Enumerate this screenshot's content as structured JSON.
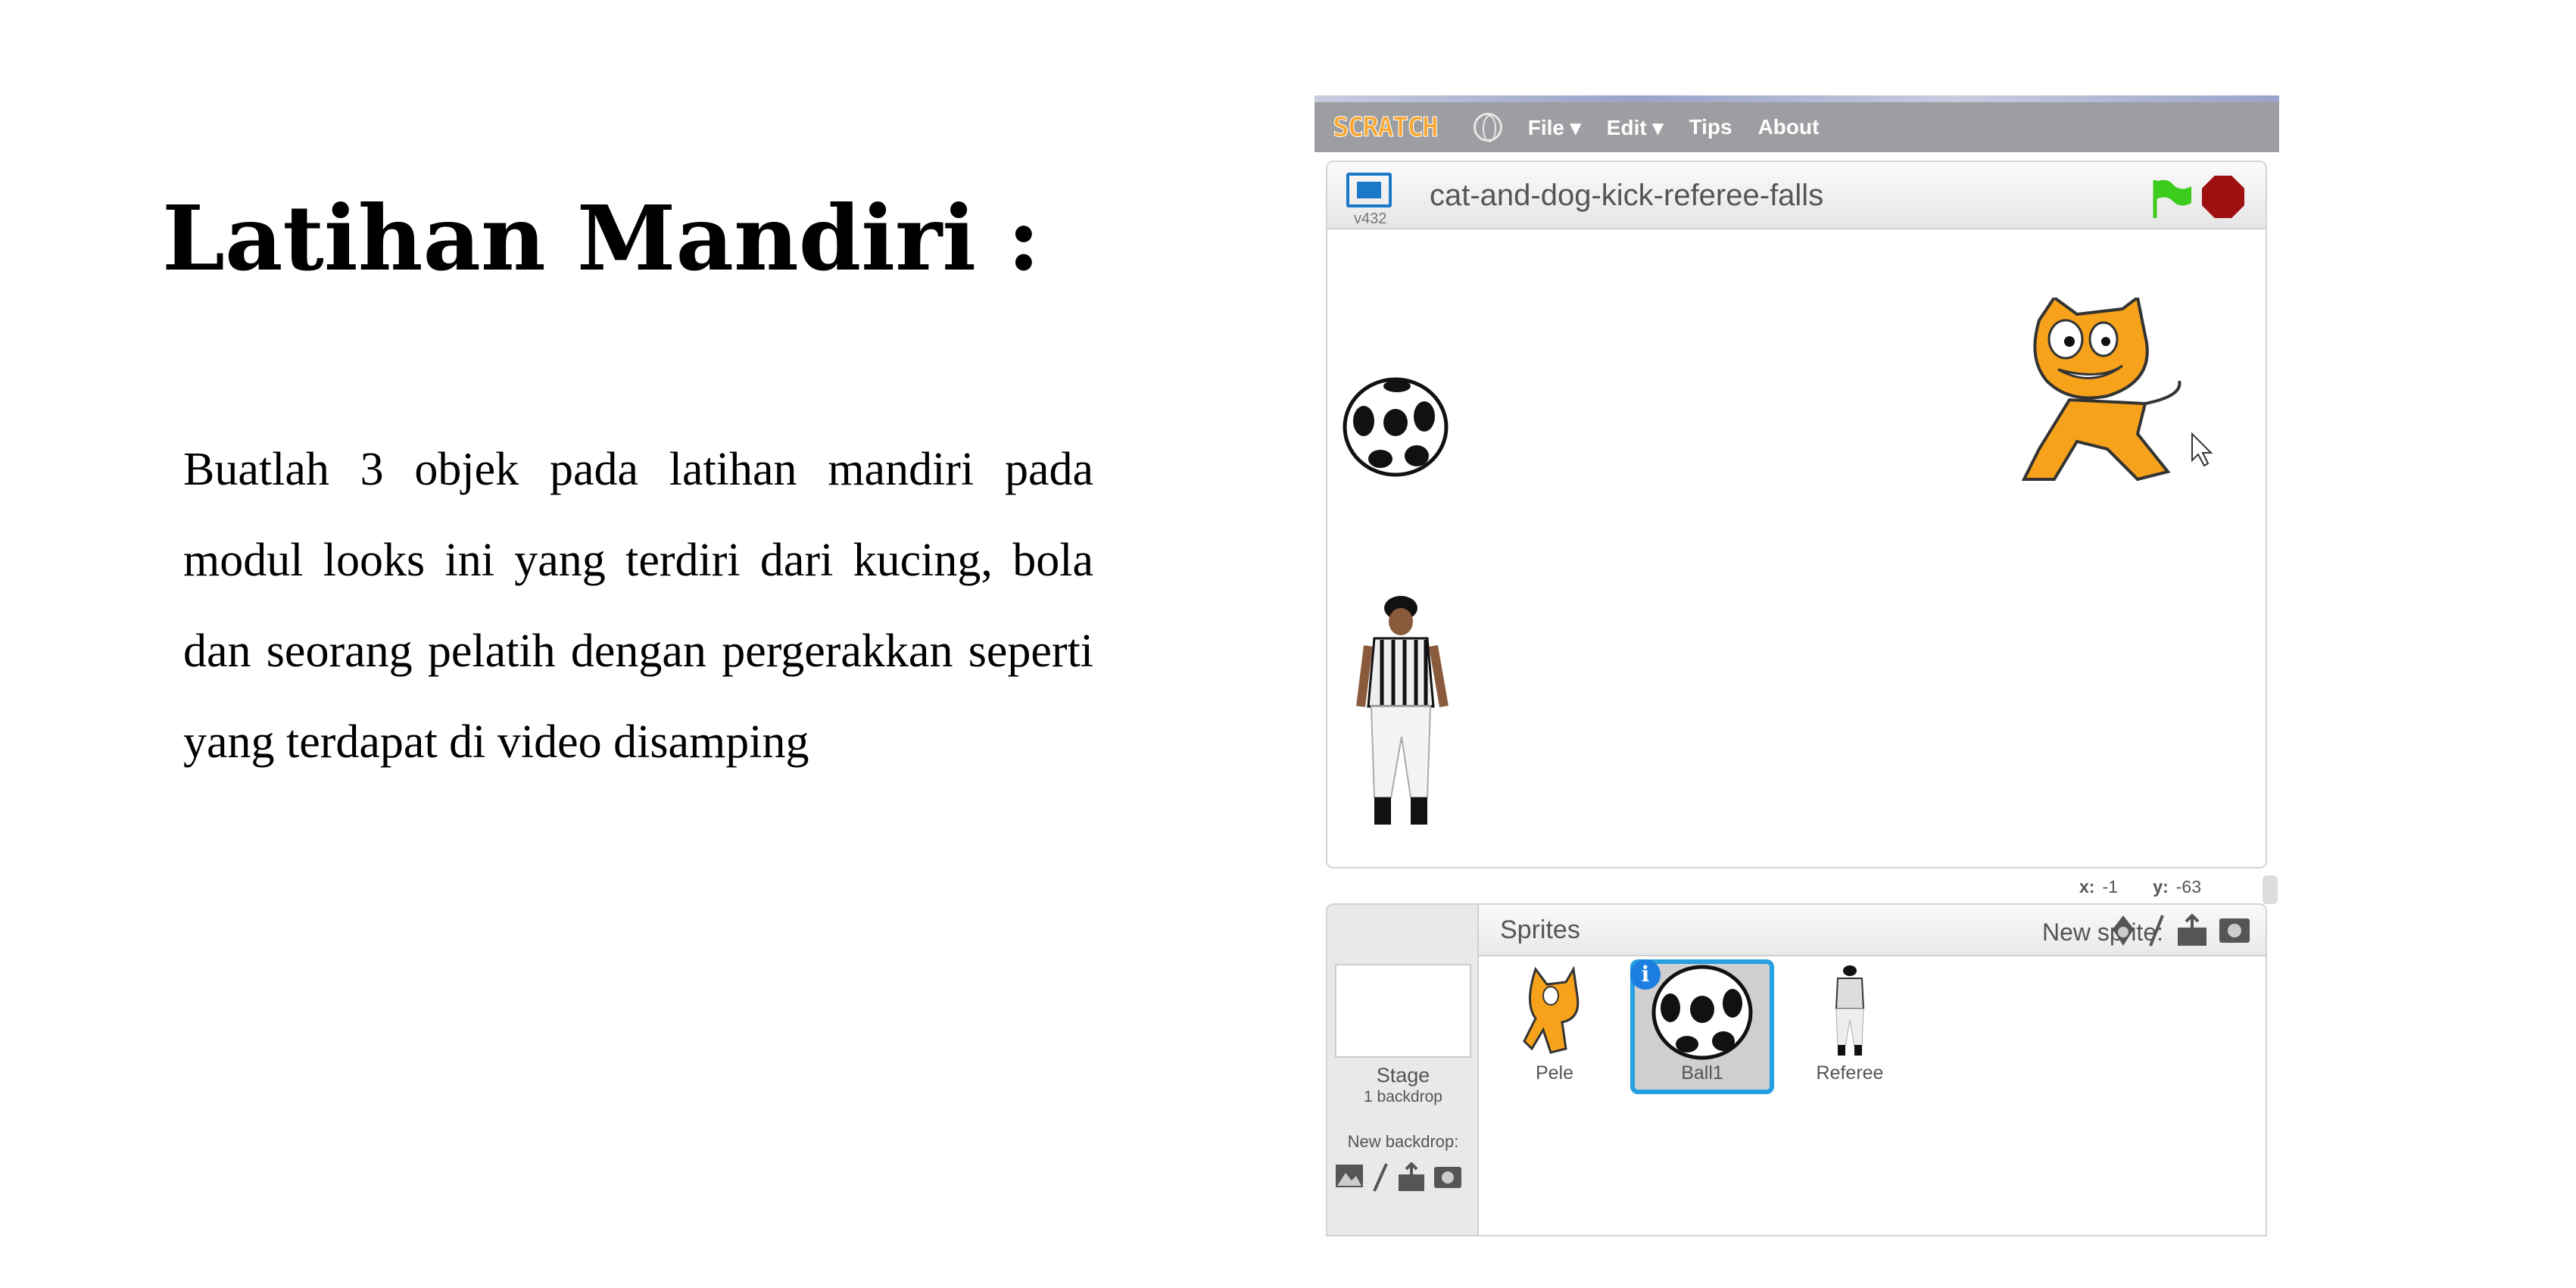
{
  "slide": {
    "title": "Latihan Mandiri :",
    "paragraph": "Buatlah 3 objek pada latihan mandiri pada modul looks ini yang terdiri dari kucing, bola dan seorang pelatih dengan pergerakkan seperti yang terdapat di video disamping"
  },
  "scratch": {
    "logo": "SCRATCH",
    "menu": [
      "File ▾",
      "Edit ▾",
      "Tips",
      "About"
    ],
    "project_title": "cat-and-dog-kick-referee-falls",
    "version": "v432",
    "coords": {
      "x_label": "x:",
      "x": "-1",
      "y_label": "y:",
      "y": "-63"
    },
    "sprites_label": "Sprites",
    "new_sprite_label": "New sprite:",
    "stage": {
      "label": "Stage",
      "backdrops": "1 backdrop",
      "new_backdrop_label": "New backdrop:"
    },
    "sprites": [
      {
        "name": "Pele",
        "selected": false
      },
      {
        "name": "Ball1",
        "selected": true
      },
      {
        "name": "Referee",
        "selected": false
      }
    ],
    "colors": {
      "menubar": "#9c9ea1",
      "selected": "#25a0e0",
      "flag": "#3ccc1c",
      "stop": "#9e1010",
      "cat": "#f7a21b"
    }
  }
}
